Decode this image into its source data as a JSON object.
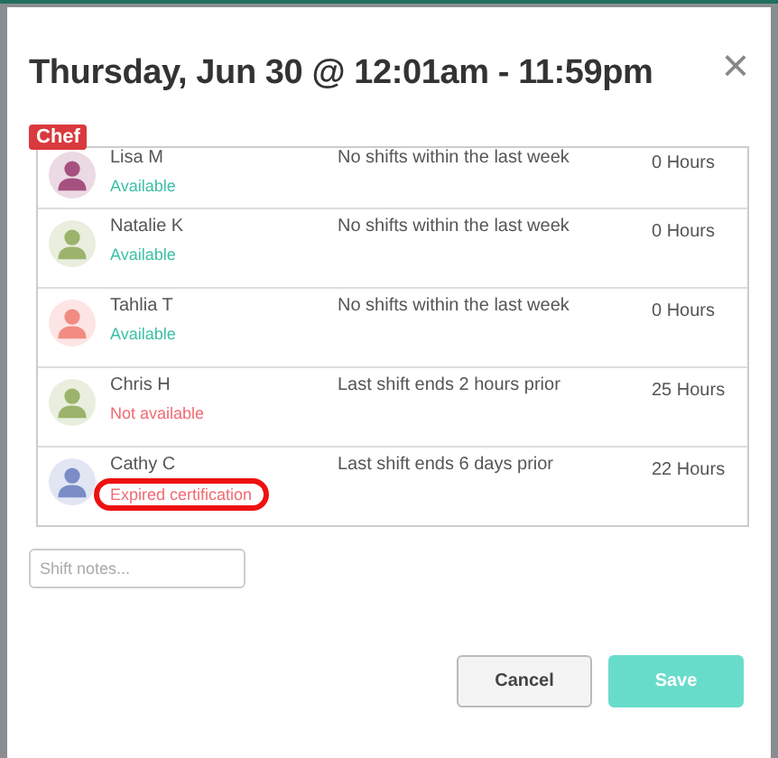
{
  "dialog": {
    "title": "Thursday, Jun 30 @ 12:01am - 11:59pm",
    "close": "×"
  },
  "role_tag": "Chef",
  "staff": [
    {
      "name": "Lisa M",
      "status": "Available",
      "available": true,
      "note": "No shifts within the last week",
      "hours": "0 Hours",
      "color": "#a5507f",
      "highlighted": false
    },
    {
      "name": "Natalie K",
      "status": "Available",
      "available": true,
      "note": "No shifts within the last week",
      "hours": "0 Hours",
      "color": "#9bb36b",
      "highlighted": false
    },
    {
      "name": "Tahlia T",
      "status": "Available",
      "available": true,
      "note": "No shifts within the last week",
      "hours": "0 Hours",
      "color": "#f28b82",
      "highlighted": false
    },
    {
      "name": "Chris H",
      "status": "Not available",
      "available": false,
      "note": "Last shift ends 2 hours prior",
      "hours": "25 Hours",
      "color": "#9bb36b",
      "highlighted": false
    },
    {
      "name": "Cathy C",
      "status": "Expired certification",
      "available": false,
      "note": "Last shift ends 6 days prior",
      "hours": "22 Hours",
      "color": "#7b8cc7",
      "highlighted": true
    }
  ],
  "notes": {
    "placeholder": "Shift notes..."
  },
  "buttons": [
    {
      "label": "Cancel",
      "kind": "secondary",
      "disabled": false
    },
    {
      "label": "Save",
      "kind": "primary",
      "disabled": true
    }
  ]
}
